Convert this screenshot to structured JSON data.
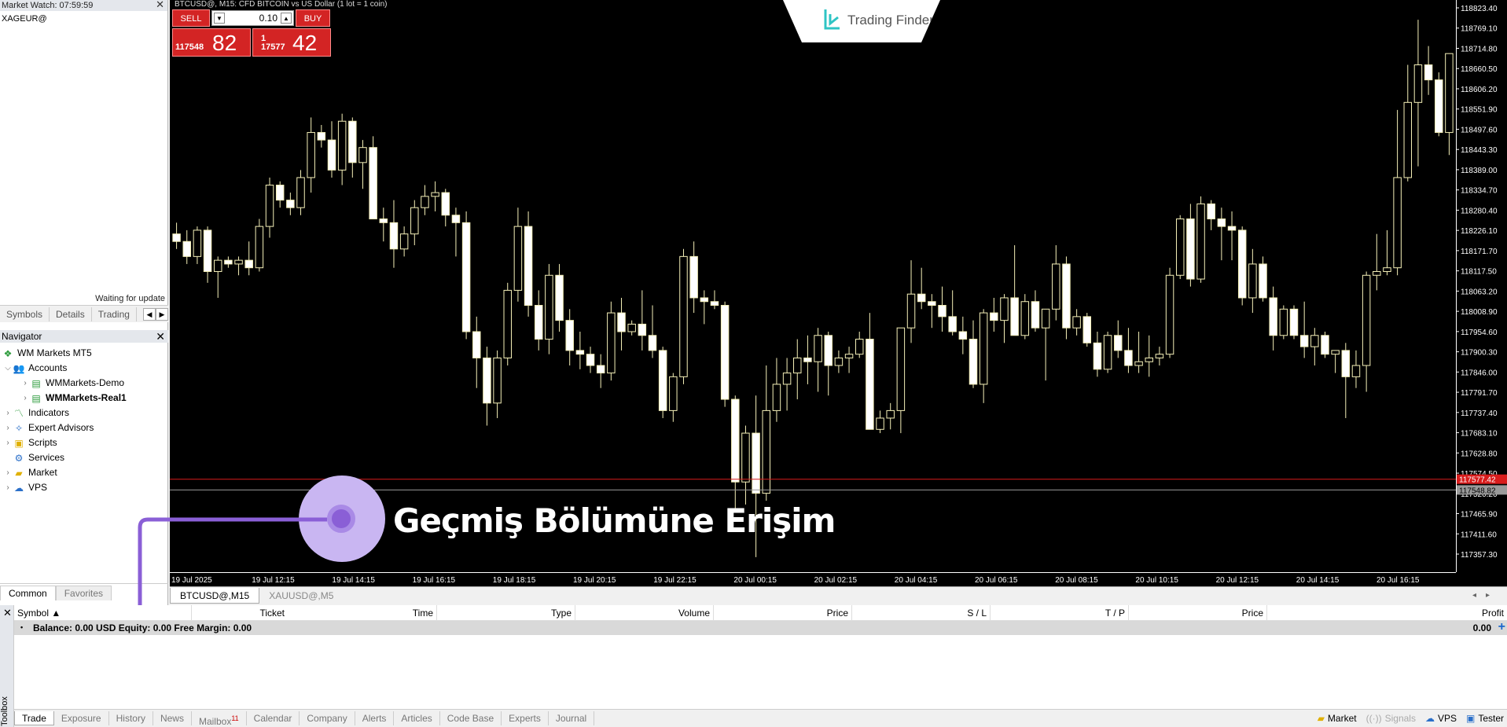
{
  "market_watch": {
    "title": "Market Watch: 07:59:59",
    "symbol": "XAGEUR@",
    "status": "Waiting for update",
    "tabs": [
      "Symbols",
      "Details",
      "Trading"
    ]
  },
  "navigator": {
    "title": "Navigator",
    "root": "WM Markets MT5",
    "accounts": "Accounts",
    "account1": "WMMarkets-Demo",
    "account2": "WMMarkets-Real1",
    "indicators": "Indicators",
    "experts": "Expert Advisors",
    "scripts": "Scripts",
    "services": "Services",
    "market": "Market",
    "vps": "VPS",
    "tabs": [
      "Common",
      "Favorites"
    ]
  },
  "chart": {
    "title": "BTCUSD@, M15:  CFD BITCOIN vs US Dollar (1 lot = 1 coin)",
    "logo": "Trading Finder",
    "sell_label": "SELL",
    "buy_label": "BUY",
    "lot": "0.10",
    "sell_small": "117548",
    "sell_big": "82",
    "buy_small": "17577",
    "buy_tiny": "1",
    "buy_big": "42",
    "annotation": "Geçmiş Bölümüne Erişim",
    "tabs": [
      "BTCUSD@,M15",
      "XAUUSD@,M5"
    ],
    "price_ticks": [
      "118823.40",
      "118769.10",
      "118714.80",
      "118660.50",
      "118606.20",
      "118551.90",
      "118497.60",
      "118443.30",
      "118389.00",
      "118334.70",
      "118280.40",
      "118226.10",
      "118171.70",
      "118117.50",
      "118063.20",
      "118008.90",
      "117954.60",
      "117900.30",
      "117846.00",
      "117791.70",
      "117737.40",
      "117683.10",
      "117628.80",
      "117574.50",
      "117520.20",
      "117465.90",
      "117411.60",
      "117357.30"
    ],
    "ask_label": "117577.42",
    "bid_label": "117548.82",
    "time_ticks": [
      "19 Jul 2025",
      "19 Jul 12:15",
      "19 Jul 14:15",
      "19 Jul 16:15",
      "19 Jul 18:15",
      "19 Jul 20:15",
      "19 Jul 22:15",
      "20 Jul 00:15",
      "20 Jul 02:15",
      "20 Jul 04:15",
      "20 Jul 06:15",
      "20 Jul 08:15",
      "20 Jul 10:15",
      "20 Jul 12:15",
      "20 Jul 14:15",
      "20 Jul 16:15"
    ]
  },
  "chart_data": {
    "type": "candlestick",
    "ylim": [
      117330,
      118840
    ],
    "candles": [
      [
        118230,
        118260,
        118190,
        118210
      ],
      [
        118210,
        118240,
        118150,
        118170
      ],
      [
        118170,
        118250,
        118150,
        118240
      ],
      [
        118240,
        118250,
        118100,
        118130
      ],
      [
        118130,
        118170,
        118060,
        118160
      ],
      [
        118160,
        118170,
        118140,
        118150
      ],
      [
        118150,
        118170,
        118120,
        118160
      ],
      [
        118160,
        118210,
        118120,
        118140
      ],
      [
        118140,
        118270,
        118130,
        118250
      ],
      [
        118250,
        118380,
        118220,
        118360
      ],
      [
        118360,
        118370,
        118300,
        118320
      ],
      [
        118320,
        118340,
        118280,
        118300
      ],
      [
        118300,
        118400,
        118280,
        118380
      ],
      [
        118380,
        118540,
        118340,
        118500
      ],
      [
        118500,
        118520,
        118460,
        118480
      ],
      [
        118480,
        118530,
        118380,
        118400
      ],
      [
        118400,
        118550,
        118360,
        118530
      ],
      [
        118530,
        118540,
        118380,
        118420
      ],
      [
        118420,
        118480,
        118350,
        118460
      ],
      [
        118460,
        118490,
        118310,
        118270
      ],
      [
        118270,
        118300,
        118210,
        118260
      ],
      [
        118260,
        118320,
        118140,
        118190
      ],
      [
        118190,
        118250,
        118170,
        118230
      ],
      [
        118230,
        118320,
        118200,
        118300
      ],
      [
        118300,
        118360,
        118280,
        118330
      ],
      [
        118330,
        118370,
        118290,
        118340
      ],
      [
        118340,
        118350,
        118250,
        118280
      ],
      [
        118280,
        118300,
        118170,
        118260
      ],
      [
        118260,
        118290,
        117950,
        117970
      ],
      [
        117970,
        118010,
        117820,
        117900
      ],
      [
        117900,
        117930,
        117720,
        117780
      ],
      [
        117780,
        117920,
        117740,
        117900
      ],
      [
        117900,
        118100,
        117880,
        118080
      ],
      [
        118080,
        118300,
        118050,
        118250
      ],
      [
        118250,
        118290,
        118010,
        118040
      ],
      [
        118040,
        118080,
        117920,
        117950
      ],
      [
        117950,
        118150,
        117910,
        118120
      ],
      [
        118120,
        118150,
        117970,
        118000
      ],
      [
        118000,
        118030,
        117880,
        117920
      ],
      [
        117920,
        117970,
        117870,
        117910
      ],
      [
        117910,
        117930,
        117860,
        117880
      ],
      [
        117880,
        117910,
        117820,
        117860
      ],
      [
        117860,
        118050,
        117840,
        118020
      ],
      [
        118020,
        118060,
        117920,
        117970
      ],
      [
        117970,
        118000,
        117960,
        117990
      ],
      [
        117990,
        118080,
        117920,
        117960
      ],
      [
        117960,
        118040,
        117900,
        117920
      ],
      [
        117920,
        117930,
        117740,
        117760
      ],
      [
        117760,
        117860,
        117730,
        117850
      ],
      [
        117850,
        118190,
        117830,
        118170
      ],
      [
        118170,
        118210,
        118020,
        118060
      ],
      [
        118060,
        118080,
        117990,
        118050
      ],
      [
        118050,
        118080,
        118030,
        118040
      ],
      [
        118040,
        118050,
        117770,
        117790
      ],
      [
        117790,
        117800,
        117490,
        117570
      ],
      [
        117570,
        117720,
        117510,
        117700
      ],
      [
        117700,
        117800,
        117370,
        117540
      ],
      [
        117540,
        117880,
        117520,
        117760
      ],
      [
        117760,
        117900,
        117730,
        117830
      ],
      [
        117830,
        117900,
        117760,
        117860
      ],
      [
        117860,
        117950,
        117790,
        117900
      ],
      [
        117900,
        117960,
        117830,
        117890
      ],
      [
        117890,
        117980,
        117810,
        117960
      ],
      [
        117960,
        117970,
        117800,
        117880
      ],
      [
        117880,
        117920,
        117860,
        117900
      ],
      [
        117900,
        117930,
        117860,
        117910
      ],
      [
        117910,
        117970,
        117900,
        117950
      ],
      [
        117950,
        118020,
        117710,
        117710
      ],
      [
        117710,
        117760,
        117700,
        117740
      ],
      [
        117740,
        117780,
        117710,
        117760
      ],
      [
        117760,
        117960,
        117700,
        117980
      ],
      [
        117980,
        118160,
        117940,
        118070
      ],
      [
        118070,
        118140,
        118030,
        118050
      ],
      [
        118050,
        118070,
        117980,
        118040
      ],
      [
        118040,
        118090,
        117970,
        118010
      ],
      [
        118010,
        118080,
        117960,
        117970
      ],
      [
        117970,
        118010,
        117910,
        117950
      ],
      [
        117950,
        118000,
        117820,
        117830
      ],
      [
        117830,
        118030,
        117780,
        118020
      ],
      [
        118020,
        118060,
        117970,
        118000
      ],
      [
        118000,
        118070,
        117940,
        118060
      ],
      [
        118060,
        118200,
        117960,
        117960
      ],
      [
        117960,
        118070,
        117950,
        118050
      ],
      [
        118050,
        118080,
        117970,
        117980
      ],
      [
        117980,
        118030,
        117840,
        118030
      ],
      [
        118030,
        118200,
        118000,
        118150
      ],
      [
        118150,
        118170,
        117950,
        117980
      ],
      [
        117980,
        118030,
        117960,
        118010
      ],
      [
        118010,
        118020,
        117930,
        117940
      ],
      [
        117940,
        117970,
        117850,
        117870
      ],
      [
        117870,
        117970,
        117860,
        117960
      ],
      [
        117960,
        118000,
        117900,
        117920
      ],
      [
        117920,
        117980,
        117860,
        117880
      ],
      [
        117880,
        117970,
        117860,
        117890
      ],
      [
        117890,
        117960,
        117850,
        117900
      ],
      [
        117900,
        117930,
        117880,
        117910
      ],
      [
        117910,
        118140,
        117900,
        118120
      ],
      [
        118120,
        118280,
        118110,
        118270
      ],
      [
        118270,
        118310,
        118090,
        118110
      ],
      [
        118110,
        118330,
        118100,
        118310
      ],
      [
        118310,
        118320,
        118240,
        118270
      ],
      [
        118270,
        118300,
        118160,
        118250
      ],
      [
        118250,
        118290,
        118160,
        118240
      ],
      [
        118240,
        118250,
        118040,
        118060
      ],
      [
        118060,
        118190,
        118020,
        118150
      ],
      [
        118150,
        118170,
        118050,
        118060
      ],
      [
        118060,
        118090,
        117920,
        117960
      ],
      [
        117960,
        118040,
        117950,
        118030
      ],
      [
        118030,
        118040,
        117950,
        117960
      ],
      [
        117960,
        118050,
        117900,
        117930
      ],
      [
        117930,
        117980,
        117880,
        117960
      ],
      [
        117960,
        117970,
        117900,
        117910
      ],
      [
        117910,
        117920,
        117860,
        117920
      ],
      [
        117920,
        117940,
        117740,
        117850
      ],
      [
        117850,
        117920,
        117820,
        117880
      ],
      [
        117880,
        118130,
        117810,
        118120
      ],
      [
        118120,
        118230,
        118080,
        118130
      ],
      [
        118130,
        118240,
        118120,
        118140
      ],
      [
        118140,
        118560,
        118120,
        118380
      ],
      [
        118380,
        118680,
        118370,
        118580
      ],
      [
        118580,
        118800,
        118410,
        118680
      ],
      [
        118680,
        118730,
        118600,
        118640
      ],
      [
        118640,
        118660,
        118490,
        118500
      ],
      [
        118500,
        118640,
        118440,
        118710
      ]
    ]
  },
  "toolbox": {
    "label": "Toolbox",
    "columns": [
      "Symbol",
      "Ticket",
      "Time",
      "Type",
      "Volume",
      "Price",
      "S / L",
      "T / P",
      "Price",
      "Profit"
    ],
    "balance": "Balance: 0.00 USD  Equity: 0.00  Free Margin: 0.00",
    "profit": "0.00",
    "tabs": [
      "Trade",
      "Exposure",
      "History",
      "News",
      "Mailbox",
      "Calendar",
      "Company",
      "Alerts",
      "Articles",
      "Code Base",
      "Experts",
      "Journal"
    ],
    "mailbox_badge": "11",
    "status": [
      "Market",
      "Signals",
      "VPS",
      "Tester"
    ]
  },
  "colors": {
    "chart_bg": "#000000",
    "candle": "#f5f0b8",
    "ask_line": "#d91c1c",
    "bid_line": "#9a9a9a",
    "accent": "#8a5fd6"
  }
}
